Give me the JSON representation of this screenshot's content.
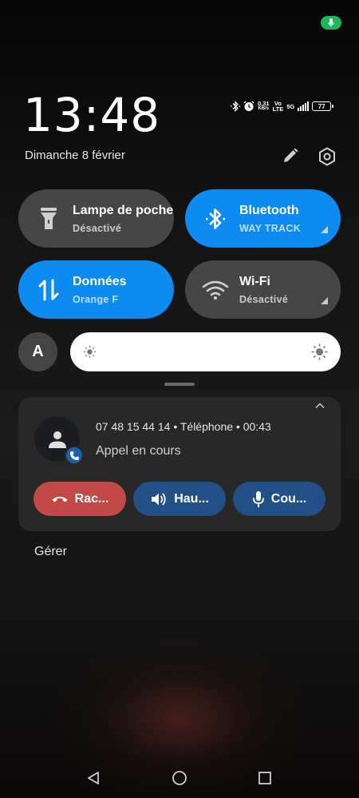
{
  "status_bar": {
    "mic_indicator": "mic-icon",
    "net_speed_value": "0.31",
    "net_speed_unit": "KB/s",
    "volte_top": "Vo",
    "volte_bottom": "LTE",
    "network": "5G",
    "battery": "77"
  },
  "clock": {
    "time": "13:48",
    "date": "Dimanche 8 février"
  },
  "tiles": [
    {
      "label": "Lampe de poche",
      "status": "Désactivé",
      "icon": "flashlight-icon",
      "active": false
    },
    {
      "label": "Bluetooth",
      "status": "WAY TRACK",
      "icon": "bluetooth-icon",
      "active": true
    },
    {
      "label": "Données",
      "status": "Orange F",
      "icon": "mobile-data-icon",
      "active": true
    },
    {
      "label": "Wi-Fi",
      "status": "Désactivé",
      "icon": "wifi-icon",
      "active": false
    }
  ],
  "brightness": {
    "auto_label": "A",
    "level": 1.0
  },
  "call": {
    "number": "07 48 15 44 14",
    "source": "Téléphone",
    "duration": "00:43",
    "separator": "•",
    "status": "Appel en cours",
    "buttons": {
      "hangup": "Rac...",
      "speaker": "Hau...",
      "mute": "Cou..."
    }
  },
  "notifications": {
    "manage_label": "Gérer"
  },
  "colors": {
    "accent": "#0d8bf0",
    "tile_off": "#464646",
    "hangup": "#c34949",
    "call_action": "#214f86",
    "mic_indicator": "#1eb656"
  }
}
